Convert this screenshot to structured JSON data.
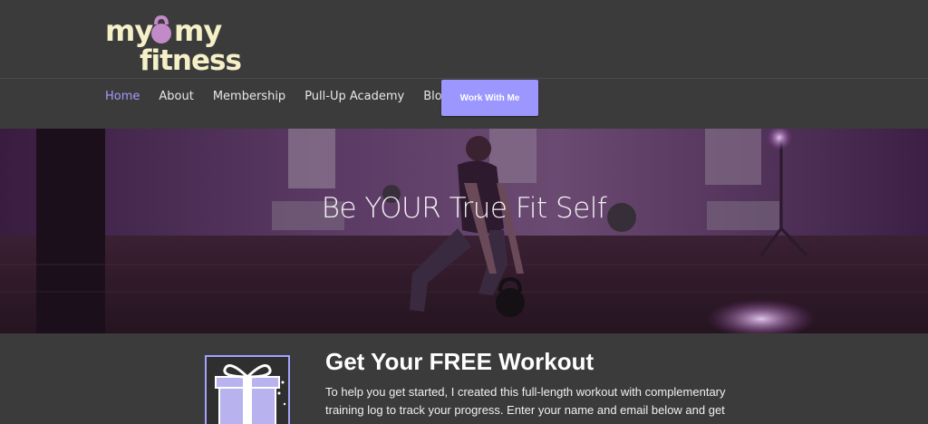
{
  "brand": {
    "line1_left": "my",
    "line1_right": "my",
    "line2": "fitness",
    "logo_icon": "kettlebell-icon",
    "logo_color": "#f5f0c8",
    "kettlebell_color": "#c28ac8"
  },
  "nav": {
    "items": [
      {
        "label": "Home",
        "active": true
      },
      {
        "label": "About",
        "active": false
      },
      {
        "label": "Membership",
        "active": false
      },
      {
        "label": "Pull-Up Academy",
        "active": false
      },
      {
        "label": "Blog",
        "active": false
      }
    ],
    "cta_label": "Work With Me",
    "active_color": "#a29bff",
    "cta_color": "#9c96ff"
  },
  "hero": {
    "title": "Be YOUR True Fit Self",
    "overlay_color": "#5a2a6a"
  },
  "offer": {
    "title": "Get Your FREE Workout",
    "text": "To help you get started, I created this full-length workout with complementary training log to track your progress. Enter your name and email below and get",
    "icon": "gift-icon",
    "accent_color": "#a6a1ff"
  }
}
